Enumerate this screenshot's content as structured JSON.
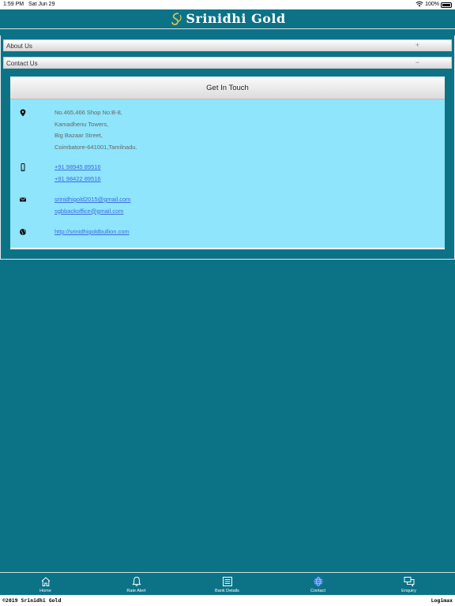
{
  "status_bar": {
    "time": "1:59 PM",
    "date": "Sat Jun 29",
    "battery": "100%"
  },
  "header": {
    "logo_text": "Srinidhi Gold"
  },
  "accordion": {
    "about_label": "About Us",
    "about_sign": "+",
    "contact_label": "Contact Us",
    "contact_sign": "−"
  },
  "card": {
    "title": "Get In Touch",
    "address": [
      "No.465,466 Shop No:B-8,",
      "Kamadhenu Towers,",
      "Big Bazaar Street,",
      "Coimbatore-641001,Tamilnadu."
    ],
    "phones": [
      "+91 98945 89516",
      "+91 98422 89516"
    ],
    "emails": [
      "srinidhigold2015@gmail.com",
      "sgbbackoffice@gmail.com"
    ],
    "website": "http://srinidhigoldbullion.com"
  },
  "tabs": [
    {
      "label": "Home",
      "icon": "home-icon"
    },
    {
      "label": "Rate Alert",
      "icon": "bell-icon"
    },
    {
      "label": "Bank Details",
      "icon": "list-icon"
    },
    {
      "label": "Contact",
      "icon": "globe-icon"
    },
    {
      "label": "Enquiry",
      "icon": "chat-icon"
    }
  ],
  "footer": {
    "copyright": "©2019 Srinidhi Gold",
    "brand": "Logimax"
  },
  "colors": {
    "app_background": "#0c7387",
    "card_background": "#8fe5fb",
    "link": "#3d6ae0",
    "active_tab_icon": "#3a7bd5"
  }
}
